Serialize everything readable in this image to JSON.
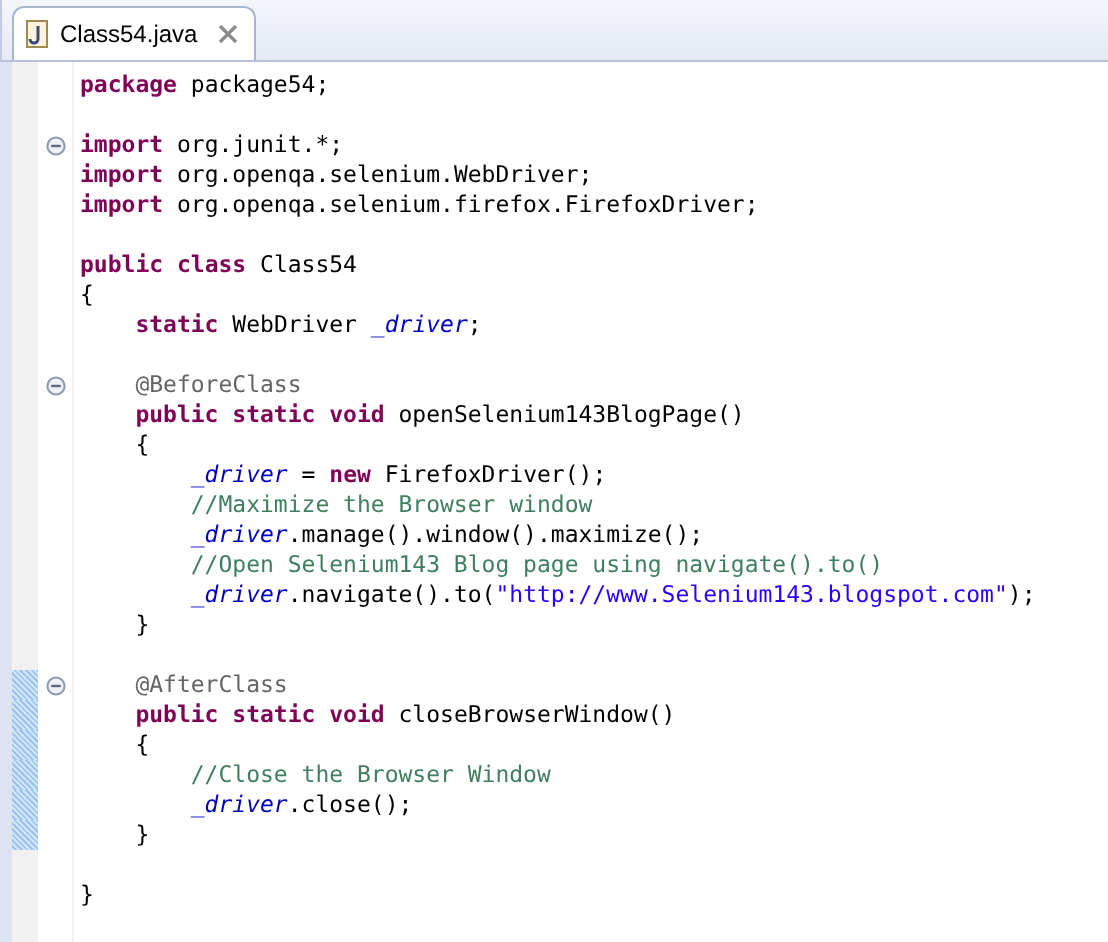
{
  "tabs": [
    {
      "label": "Class54.java",
      "selected": true
    }
  ],
  "lines": [
    {
      "kind": "code",
      "tokens": [
        {
          "kind": "keyword",
          "s": "package"
        },
        {
          "kind": "plain",
          "s": " package54;"
        }
      ]
    },
    {
      "kind": "blank"
    },
    {
      "kind": "code",
      "fold": true,
      "tokens": [
        {
          "kind": "keyword",
          "s": "import"
        },
        {
          "kind": "plain",
          "s": " org.junit.*;"
        }
      ]
    },
    {
      "kind": "code",
      "tokens": [
        {
          "kind": "keyword",
          "s": "import"
        },
        {
          "kind": "plain",
          "s": " org.openqa.selenium.WebDriver;"
        }
      ]
    },
    {
      "kind": "code",
      "tokens": [
        {
          "kind": "keyword",
          "s": "import"
        },
        {
          "kind": "plain",
          "s": " org.openqa.selenium.firefox.FirefoxDriver;"
        }
      ]
    },
    {
      "kind": "blank"
    },
    {
      "kind": "code",
      "tokens": [
        {
          "kind": "keyword",
          "s": "public"
        },
        {
          "kind": "keyword",
          "s": " class"
        },
        {
          "kind": "plain",
          "s": " Class54"
        }
      ]
    },
    {
      "kind": "code",
      "tokens": [
        {
          "kind": "plain",
          "s": "{"
        }
      ]
    },
    {
      "kind": "code",
      "tokens": [
        {
          "kind": "keyword",
          "s": "    static"
        },
        {
          "kind": "plain",
          "s": " WebDriver "
        },
        {
          "kind": "field",
          "s": "_driver"
        },
        {
          "kind": "plain",
          "s": ";"
        }
      ]
    },
    {
      "kind": "blank"
    },
    {
      "kind": "code",
      "fold": true,
      "tokens": [
        {
          "kind": "annotation",
          "s": "    @BeforeClass"
        }
      ]
    },
    {
      "kind": "code",
      "tokens": [
        {
          "kind": "keyword",
          "s": "    public static void"
        },
        {
          "kind": "plain",
          "s": " openSelenium143BlogPage()"
        }
      ]
    },
    {
      "kind": "code",
      "tokens": [
        {
          "kind": "plain",
          "s": "    {"
        }
      ]
    },
    {
      "kind": "code",
      "tokens": [
        {
          "kind": "field",
          "s": "        _driver"
        },
        {
          "kind": "plain",
          "s": " = "
        },
        {
          "kind": "keyword",
          "s": "new"
        },
        {
          "kind": "plain",
          "s": " FirefoxDriver();"
        }
      ]
    },
    {
      "kind": "code",
      "tokens": [
        {
          "kind": "comment",
          "s": "        //Maximize the Browser window"
        }
      ]
    },
    {
      "kind": "code",
      "tokens": [
        {
          "kind": "field",
          "s": "        _driver"
        },
        {
          "kind": "plain",
          "s": ".manage().window().maximize();"
        }
      ]
    },
    {
      "kind": "code",
      "tokens": [
        {
          "kind": "comment",
          "s": "        //Open Selenium143 Blog page using navigate().to()"
        }
      ]
    },
    {
      "kind": "code",
      "tokens": [
        {
          "kind": "field",
          "s": "        _driver"
        },
        {
          "kind": "plain",
          "s": ".navigate().to("
        },
        {
          "kind": "string",
          "s": "\"http://www.Selenium143.blogspot.com\""
        },
        {
          "kind": "plain",
          "s": ");"
        }
      ]
    },
    {
      "kind": "code",
      "tokens": [
        {
          "kind": "plain",
          "s": "    }"
        }
      ]
    },
    {
      "kind": "blank"
    },
    {
      "kind": "code",
      "fold": true,
      "changed": true,
      "tokens": [
        {
          "kind": "annotation",
          "s": "    @AfterClass"
        }
      ]
    },
    {
      "kind": "code",
      "changed": true,
      "tokens": [
        {
          "kind": "keyword",
          "s": "    public static void"
        },
        {
          "kind": "plain",
          "s": " closeBrowserWindow()"
        }
      ]
    },
    {
      "kind": "code",
      "changed": true,
      "tokens": [
        {
          "kind": "plain",
          "s": "    {"
        }
      ]
    },
    {
      "kind": "code",
      "changed": true,
      "tokens": [
        {
          "kind": "comment",
          "s": "        //Close the Browser Window"
        }
      ]
    },
    {
      "kind": "code",
      "changed": true,
      "tokens": [
        {
          "kind": "field",
          "s": "        _driver"
        },
        {
          "kind": "plain",
          "s": ".close();"
        }
      ]
    },
    {
      "kind": "code",
      "changed": true,
      "tokens": [
        {
          "kind": "plain",
          "s": "    }"
        }
      ]
    },
    {
      "kind": "blank"
    },
    {
      "kind": "code",
      "tokens": [
        {
          "kind": "plain",
          "s": "}"
        }
      ]
    },
    {
      "kind": "blank"
    }
  ]
}
